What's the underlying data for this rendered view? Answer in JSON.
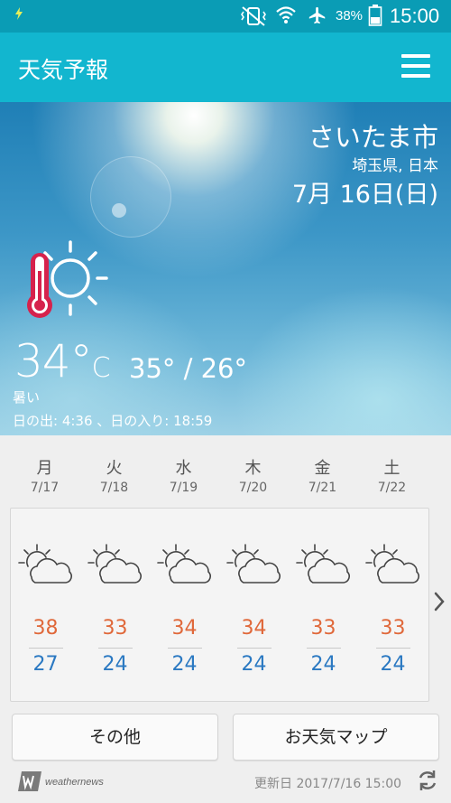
{
  "status_bar": {
    "battery": "38%",
    "time": "15:00"
  },
  "app_bar": {
    "title": "天気予報"
  },
  "current": {
    "city": "さいたま市",
    "region": "埼玉県, 日本",
    "date": "7月 16日(日)",
    "temp": "34°",
    "temp_unit": "C",
    "hi_lo": "35° / 26°",
    "condition": "暑い",
    "sun_times": "日の出: 4:36 、日の入り: 18:59",
    "icon": "hot-sun-thermometer-icon"
  },
  "forecast": [
    {
      "dow": "月",
      "date": "7/17",
      "icon": "partly-cloudy-icon",
      "high": "38",
      "low": "27"
    },
    {
      "dow": "火",
      "date": "7/18",
      "icon": "partly-cloudy-icon",
      "high": "33",
      "low": "24"
    },
    {
      "dow": "水",
      "date": "7/19",
      "icon": "partly-cloudy-icon",
      "high": "34",
      "low": "24"
    },
    {
      "dow": "木",
      "date": "7/20",
      "icon": "partly-cloudy-icon",
      "high": "34",
      "low": "24"
    },
    {
      "dow": "金",
      "date": "7/21",
      "icon": "partly-cloudy-icon",
      "high": "33",
      "low": "24"
    },
    {
      "dow": "土",
      "date": "7/22",
      "icon": "partly-cloudy-icon",
      "high": "33",
      "low": "24"
    }
  ],
  "buttons": {
    "other": "その他",
    "weather_map": "お天気マップ"
  },
  "footer": {
    "brand": "weathernews",
    "updated": "更新日 2017/7/16 15:00"
  },
  "colors": {
    "status_bar": "#0a9cb5",
    "app_bar": "#12b6cf",
    "high_temp": "#e0683a",
    "low_temp": "#2b79c2",
    "thermometer": "#d6224c"
  }
}
